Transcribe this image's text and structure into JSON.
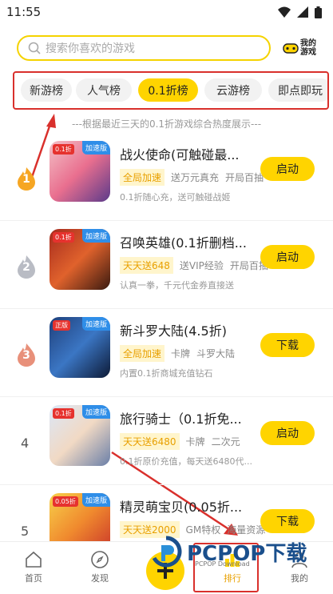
{
  "status": {
    "time": "11:55"
  },
  "search": {
    "placeholder": "搜索你喜欢的游戏"
  },
  "my_games": {
    "label": "我的游戏"
  },
  "tabs": [
    "新游榜",
    "人气榜",
    "0.1折榜",
    "云游榜",
    "即点即玩"
  ],
  "note": "---根据最近三天的0.1折游戏综合热度展示---",
  "games": [
    {
      "rank": "1",
      "title": "战火使命(可触碰最...",
      "tag": "全局加速",
      "meta1": "送万元真充",
      "meta2": "开局百抽",
      "desc": "0.1折随心充，送可触碰战姬",
      "button": "启动",
      "chip": "加速版",
      "chip_left": "0.1折"
    },
    {
      "rank": "2",
      "title": "召唤英雄(0.1折删档...",
      "tag": "天天送648",
      "meta1": "送VIP经验",
      "meta2": "开局百抽",
      "desc": "认真一拳，千元代金券直接送",
      "button": "启动",
      "chip": "加速版",
      "chip_left": "0.1折"
    },
    {
      "rank": "3",
      "title": "新斗罗大陆(4.5折)",
      "tag": "全局加速",
      "meta1": "卡牌",
      "meta2": "斗罗大陆",
      "desc": "内置0.1折商城充值钻石",
      "button": "下载",
      "chip": "加速版",
      "chip_left": "正版"
    },
    {
      "rank": "4",
      "title": "旅行骑士（0.1折免...",
      "tag": "天天送6480",
      "meta1": "卡牌",
      "meta2": "二次元",
      "desc": "0.1折原价充值，每天送6480代...",
      "button": "启动",
      "chip": "加速版",
      "chip_left": "0.1折"
    },
    {
      "rank": "5",
      "title": "精灵萌宝贝(0.05折...",
      "tag": "天天送2000",
      "meta1": "GM特权",
      "meta2": "海量资源",
      "desc": "",
      "button": "下载",
      "chip": "加速版",
      "chip_left": "0.05折"
    }
  ],
  "bottom_nav": {
    "home": "首页",
    "discover": "发现",
    "rank": "排行",
    "mine": "我的"
  },
  "watermark": {
    "text": "PCPOP下载",
    "sub": "PCPOP Download"
  },
  "colors": {
    "accent": "#ffd400",
    "highlight": "#d9302c"
  }
}
